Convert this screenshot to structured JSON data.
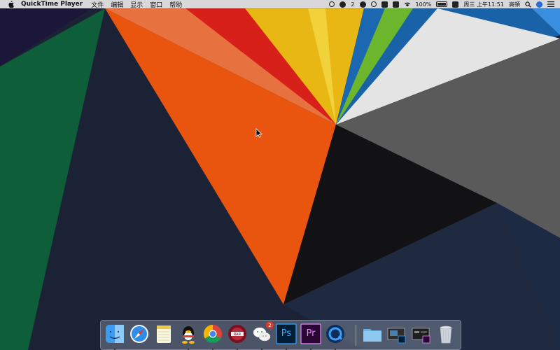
{
  "menubar": {
    "app_name": "QuickTime Player",
    "menus": [
      "文件",
      "编辑",
      "显示",
      "窗口",
      "帮助"
    ],
    "status": {
      "wechat_count": "2",
      "battery": "100%",
      "datetime": "周三 上午11:51",
      "input_method": "高頓"
    }
  },
  "dock": {
    "apps": [
      {
        "name": "finder-icon",
        "running": true
      },
      {
        "name": "safari-icon",
        "running": false
      },
      {
        "name": "notes-icon",
        "running": false
      },
      {
        "name": "qq-icon",
        "running": true
      },
      {
        "name": "chrome-icon",
        "running": true
      },
      {
        "name": "winrar-icon",
        "running": true
      },
      {
        "name": "wechat-icon",
        "running": true,
        "badge": "2"
      },
      {
        "name": "photoshop-icon",
        "label": "Ps",
        "running": true
      },
      {
        "name": "premiere-icon",
        "label": "Pr",
        "running": true
      },
      {
        "name": "quicktime-icon",
        "running": true
      }
    ],
    "trash": "trash-icon"
  },
  "colors": {
    "orange": "#e8530f",
    "navy": "#1b2235",
    "green": "#0d5f3a",
    "menubar": "#e8e8e8"
  }
}
